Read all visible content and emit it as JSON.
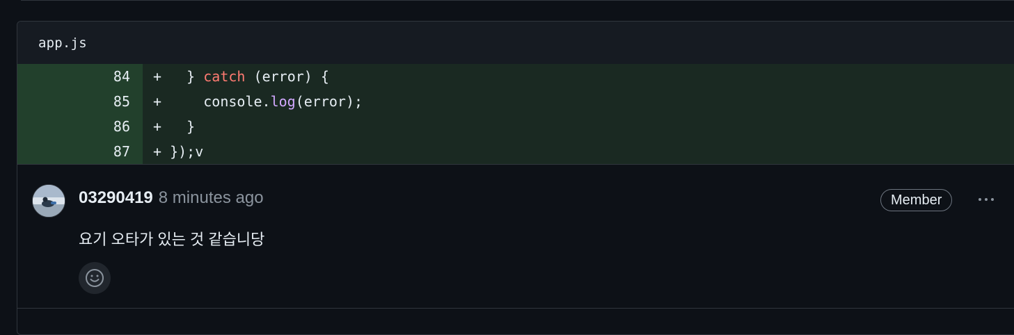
{
  "file": {
    "name": "app.js"
  },
  "diff": {
    "lines": [
      {
        "number": "84",
        "marker": "+",
        "segments": [
          {
            "text": "  } ",
            "cls": ""
          },
          {
            "text": "catch",
            "cls": "tok-kw"
          },
          {
            "text": " (error) {",
            "cls": ""
          }
        ]
      },
      {
        "number": "85",
        "marker": "+",
        "segments": [
          {
            "text": "    console.",
            "cls": ""
          },
          {
            "text": "log",
            "cls": "tok-fn"
          },
          {
            "text": "(error);",
            "cls": ""
          }
        ]
      },
      {
        "number": "86",
        "marker": "+",
        "segments": [
          {
            "text": "  }",
            "cls": ""
          }
        ]
      },
      {
        "number": "87",
        "marker": "+",
        "segments": [
          {
            "text": "});v",
            "cls": ""
          }
        ]
      }
    ]
  },
  "comment": {
    "author": "03290419",
    "timestamp": "8 minutes ago",
    "badge": "Member",
    "body": "요기 오타가 있는 것 같습니당",
    "reaction_icon": "smiley-icon",
    "menu_icon": "kebab-horizontal-icon"
  },
  "colors": {
    "background": "#0d1117",
    "header_bg": "#161b22",
    "added_line_bg": "#1a2922",
    "added_num_bg": "#22402c",
    "keyword": "#ff7b72",
    "function": "#d2a8ff",
    "muted": "#8b949e"
  }
}
